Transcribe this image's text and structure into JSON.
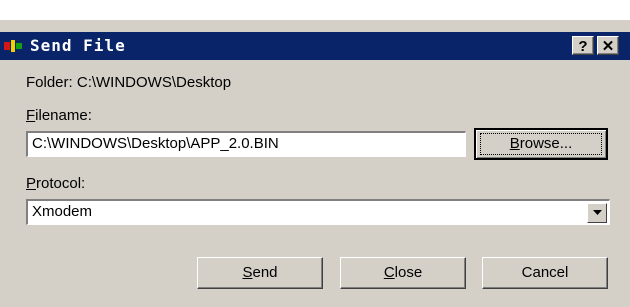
{
  "window": {
    "title": "Send File",
    "help_glyph": "?",
    "close_glyph": "✕",
    "titlebar_color": "#0a246a",
    "face_color": "#d4d0c8"
  },
  "folder": {
    "label": "Folder:",
    "value": "C:\\WINDOWS\\Desktop"
  },
  "filename": {
    "label_first": "F",
    "label_rest": "ilename:",
    "value": "C:\\WINDOWS\\Desktop\\APP_2.0.BIN",
    "browse_first": "B",
    "browse_rest": "rowse..."
  },
  "protocol": {
    "label_first": "P",
    "label_rest": "rotocol:",
    "selected": "Xmodem"
  },
  "buttons": {
    "send_first": "S",
    "send_rest": "end",
    "close_first": "C",
    "close_rest": "lose",
    "cancel": "Cancel"
  }
}
